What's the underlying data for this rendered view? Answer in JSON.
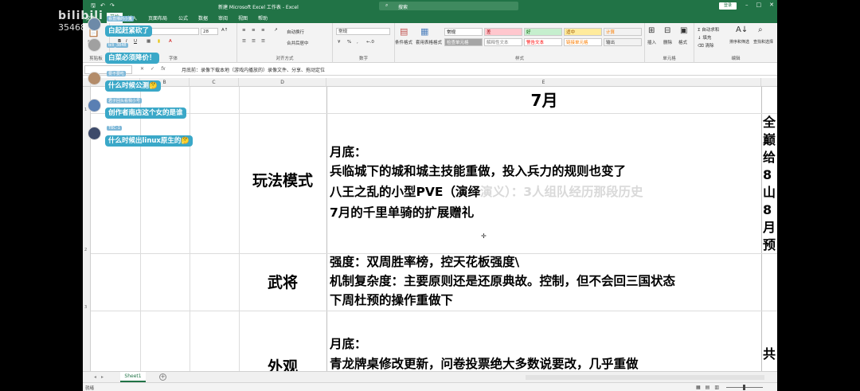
{
  "watermark": {
    "brand": "bilibili",
    "number": "354687"
  },
  "titlebar": {
    "window_title": "新建 Microsoft Excel 工作表 - Excel",
    "search_placeholder": "搜索",
    "login_label": "登录",
    "qat": [
      "save",
      "undo",
      "redo"
    ]
  },
  "tabs": [
    "文件",
    "开始",
    "插入",
    "页面布局",
    "公式",
    "数据",
    "审阅",
    "视图",
    "帮助"
  ],
  "active_tab": "开始",
  "ribbon": {
    "clipboard": {
      "label": "剪贴板",
      "paste": "粘贴"
    },
    "font": {
      "label": "字体",
      "font_size": "28"
    },
    "alignment": {
      "label": "对齐方式",
      "wrap": "自动换行",
      "merge": "合并后居中"
    },
    "number": {
      "label": "数字",
      "format": "常规"
    },
    "styles": {
      "label": "样式",
      "cond_format": "条件格式",
      "table_format": "套用表格格式",
      "cells": [
        {
          "text": "常规",
          "bg": "#ffffff",
          "fg": "#000000"
        },
        {
          "text": "差",
          "bg": "#ffc7ce",
          "fg": "#9c0006"
        },
        {
          "text": "好",
          "bg": "#c6efce",
          "fg": "#006100"
        },
        {
          "text": "适中",
          "bg": "#ffeb9c",
          "fg": "#9c5700"
        },
        {
          "text": "计算",
          "bg": "#f2f2f2",
          "fg": "#fa7d00"
        },
        {
          "text": "检查单元格",
          "bg": "#a5a5a5",
          "fg": "#ffffff"
        },
        {
          "text": "解释性文本",
          "bg": "#ffffff",
          "fg": "#7f7f7f"
        },
        {
          "text": "警告文本",
          "bg": "#ffffff",
          "fg": "#ff0000"
        },
        {
          "text": "链接单元格",
          "bg": "#ffffff",
          "fg": "#fa7d00"
        },
        {
          "text": "输出",
          "bg": "#f2f2f2",
          "fg": "#3f3f3f"
        }
      ]
    },
    "cells_group": {
      "label": "单元格",
      "insert": "插入",
      "delete": "删除",
      "format": "格式"
    },
    "editing": {
      "label": "编辑",
      "autosum": "自动求和",
      "fill": "填充",
      "clear": "清除",
      "sort": "排序和筛选",
      "find": "查找和选择"
    }
  },
  "formula_bar": {
    "content": "月底前：录像下载本地（游戏内播放的）录像文件、分享、拖动定位"
  },
  "columns": [
    "A",
    "B",
    "C",
    "D",
    "E"
  ],
  "rows": [
    "1",
    "2",
    "3"
  ],
  "sheet": {
    "title": "7月",
    "sections": [
      {
        "label": "玩法模式",
        "lines": [
          "月底：",
          "兵临城下的城和城主技能重做，投入兵力的规则也变了",
          "八王之乱的小型PVE（演绎",
          "7月的千里单骑的扩展赠礼"
        ],
        "ghost_tail": "演义）：3人组队经历那段历史"
      },
      {
        "label": "武将",
        "lines": [
          "强度：双周胜率榜，控天花板强度\\",
          "机制复杂度：主要原则还是还原典故。控制，但不会回三国状态",
          "下周杜预的操作重做下"
        ]
      },
      {
        "label": "外观",
        "lines": [
          "月底：",
          "青龙牌桌修改更新，问卷投票绝大多数说要改，几乎重做"
        ]
      }
    ],
    "overflow_right_top": [
      "全",
      "巅",
      "给",
      "8",
      "山",
      "8月",
      "预"
    ],
    "overflow_right_bottom": [
      "共"
    ]
  },
  "sheet_tab": "Sheet1",
  "status": {
    "ready": "就绪"
  },
  "danmaku": [
    {
      "user": "看直播的小鬼",
      "text": "白起赶紧砍了",
      "avatar": "#6d8aa8"
    },
    {
      "user": "bili_3848",
      "text": "白菜必须降价！",
      "avatar": "#a0a0a0"
    },
    {
      "user": "要不要吃",
      "text": "什么时候公测",
      "emoji": "🤔",
      "avatar": "#b38c6a"
    },
    {
      "user": "君子回头看我小号",
      "text": "创作者南店这个女的是谁",
      "avatar": "#5a7fb3"
    },
    {
      "user": "TBC-1",
      "text": "什么时候出linux原生的",
      "emoji": "🤔",
      "avatar": "#3d4a6a"
    }
  ]
}
